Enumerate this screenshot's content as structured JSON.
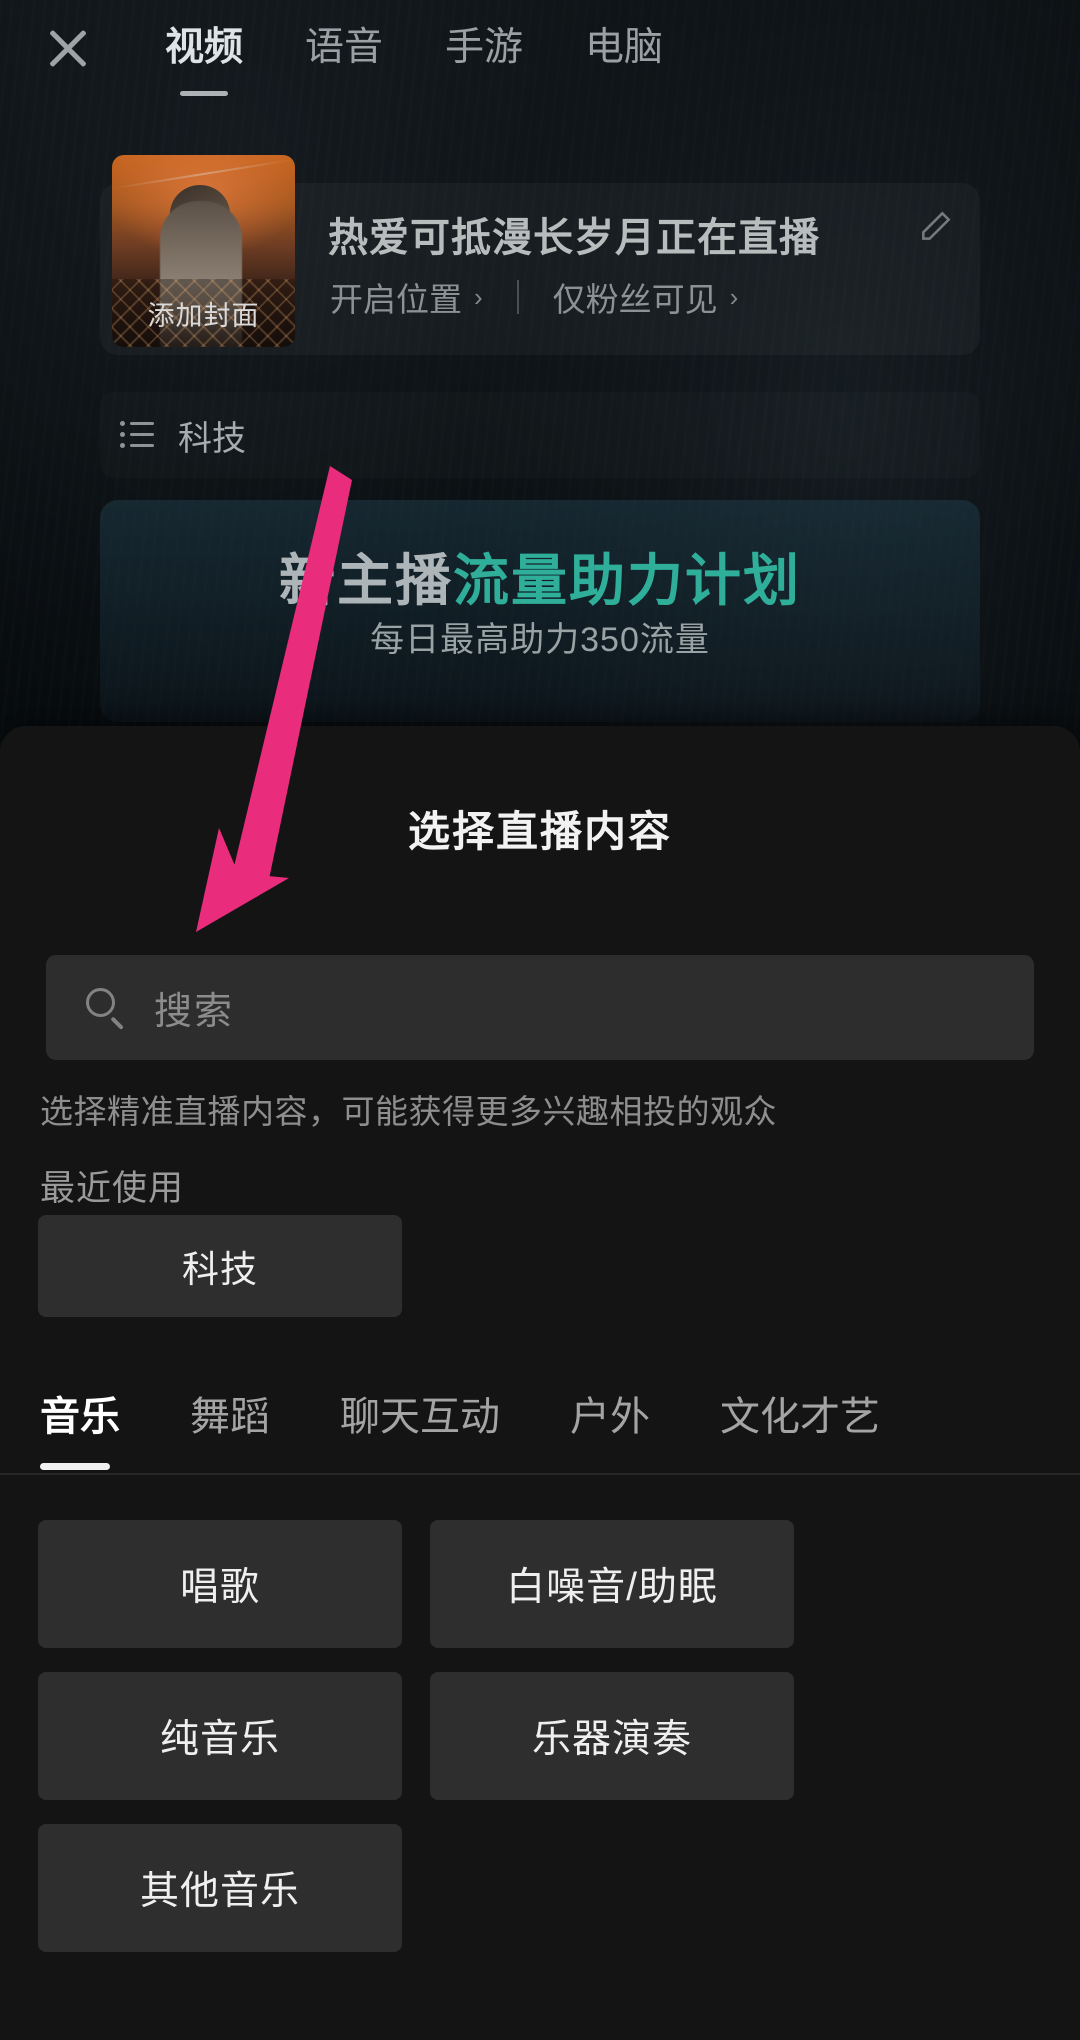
{
  "background": {
    "topnav": {
      "close_icon": "close-icon",
      "tabs": [
        {
          "label": "视频",
          "active": true
        },
        {
          "label": "语音",
          "active": false
        },
        {
          "label": "手游",
          "active": false
        },
        {
          "label": "电脑",
          "active": false
        }
      ]
    },
    "info_card": {
      "cover_label": "添加封面",
      "live_title": "热爱可抵漫长岁月正在直播",
      "edit_icon": "pencil-icon",
      "location_label": "开启位置",
      "location_chevron": "›",
      "visibility_label": "仅粉丝可见",
      "visibility_chevron": "›"
    },
    "category_row": {
      "icon": "list-icon",
      "label": "科技"
    },
    "promo": {
      "title_part1": "新主播",
      "title_part2": "流量助力计划",
      "subtitle": "每日最高助力350流量",
      "accent_color": "#2fae9a"
    }
  },
  "sheet": {
    "title": "选择直播内容",
    "search": {
      "icon": "search-icon",
      "placeholder": "搜索",
      "value": ""
    },
    "hint": "选择精准直播内容，可能获得更多兴趣相投的观众",
    "recent": {
      "label": "最近使用",
      "items": [
        {
          "label": "科技"
        }
      ]
    },
    "tabs": [
      {
        "label": "音乐",
        "active": true
      },
      {
        "label": "舞蹈",
        "active": false
      },
      {
        "label": "聊天互动",
        "active": false
      },
      {
        "label": "户外",
        "active": false
      },
      {
        "label": "文化才艺",
        "active": false
      }
    ],
    "grid_items": [
      {
        "label": "唱歌"
      },
      {
        "label": "白噪音/助眠"
      },
      {
        "label": "纯音乐"
      },
      {
        "label": "乐器演奏"
      },
      {
        "label": "其他音乐"
      }
    ]
  },
  "annotation": {
    "arrow_color": "#ea2c7d",
    "arrow_points_to": "search-input"
  }
}
